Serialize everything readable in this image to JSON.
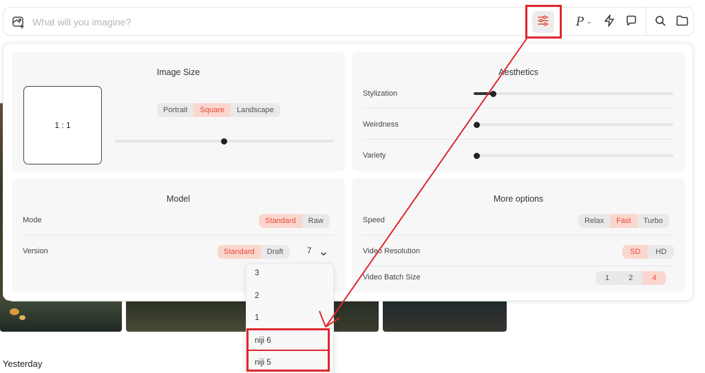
{
  "topbar": {
    "prompt_placeholder": "What will you imagine?",
    "p_label": "P",
    "chevron": "⌄"
  },
  "image_size": {
    "title": "Image Size",
    "ratio_label": "1 : 1",
    "orientations": [
      "Portrait",
      "Square",
      "Landscape"
    ],
    "selected": "Square"
  },
  "aesthetics": {
    "title": "Aesthetics",
    "sliders": [
      {
        "label": "Stylization",
        "value": 0.1
      },
      {
        "label": "Weirdness",
        "value": 0.0
      },
      {
        "label": "Variety",
        "value": 0.0
      }
    ]
  },
  "model": {
    "title": "Model",
    "mode_label": "Mode",
    "mode_options": [
      "Standard",
      "Raw"
    ],
    "mode_selected": "Standard",
    "version_label": "Version",
    "version_options": [
      "Standard",
      "Draft"
    ],
    "version_selected": "Standard",
    "version_value": "7"
  },
  "more_options": {
    "title": "More options",
    "speed_label": "Speed",
    "speed_options": [
      "Relax",
      "Fast",
      "Turbo"
    ],
    "speed_selected": "Fast",
    "resolution_label": "Video Resolution",
    "resolution_options": [
      "SD",
      "HD"
    ],
    "resolution_selected": "SD",
    "batch_label": "Video Batch Size",
    "batch_options": [
      "1",
      "2",
      "4"
    ],
    "batch_selected": "4"
  },
  "version_dropdown": {
    "items": [
      "3",
      "2",
      "1",
      "niji 6",
      "niji 5"
    ]
  },
  "gallery": {
    "section_label": "Yesterday"
  },
  "colors": {
    "accent": "#e8493a",
    "accent_bg": "#fbd6cf",
    "annotation_red": "#e0252c"
  }
}
